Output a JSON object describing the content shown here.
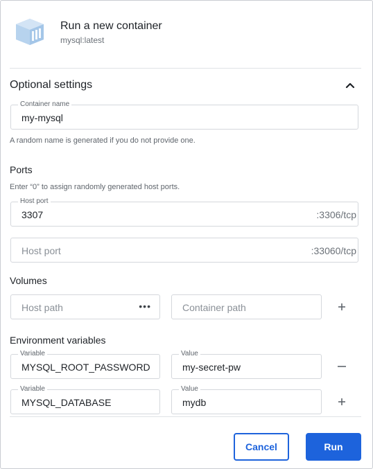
{
  "header": {
    "title": "Run a new container",
    "image_name": "mysql:latest",
    "icon": "docker-image-icon"
  },
  "optional": {
    "title": "Optional settings",
    "collapse_icon": "chevron-up-icon",
    "container_name_label": "Container name",
    "container_name_value": "my-mysql",
    "container_name_hint": "A random name is generated if you do not provide one."
  },
  "ports": {
    "heading": "Ports",
    "hint": "Enter “0” to assign randomly generated host ports.",
    "rows": [
      {
        "label": "Host port",
        "value": "3307",
        "container_port": ":3306/tcp"
      },
      {
        "placeholder": "Host port",
        "container_port": ":33060/tcp"
      }
    ]
  },
  "volumes": {
    "heading": "Volumes",
    "host_placeholder": "Host path",
    "browse_icon": "more-horizontal-icon",
    "container_placeholder": "Container path",
    "add_icon": "plus-icon"
  },
  "env": {
    "heading": "Environment variables",
    "variable_label": "Variable",
    "value_label": "Value",
    "rows": [
      {
        "variable": "MYSQL_ROOT_PASSWORD",
        "value": "my-secret-pw",
        "action_icon": "minus-icon"
      },
      {
        "variable": "MYSQL_DATABASE",
        "value": "mydb",
        "action_icon": "plus-icon"
      }
    ]
  },
  "footer": {
    "cancel_label": "Cancel",
    "run_label": "Run"
  },
  "colors": {
    "accent": "#1d63dc",
    "icon_blue": "#b7d3ee",
    "border": "#d4d7dc"
  }
}
